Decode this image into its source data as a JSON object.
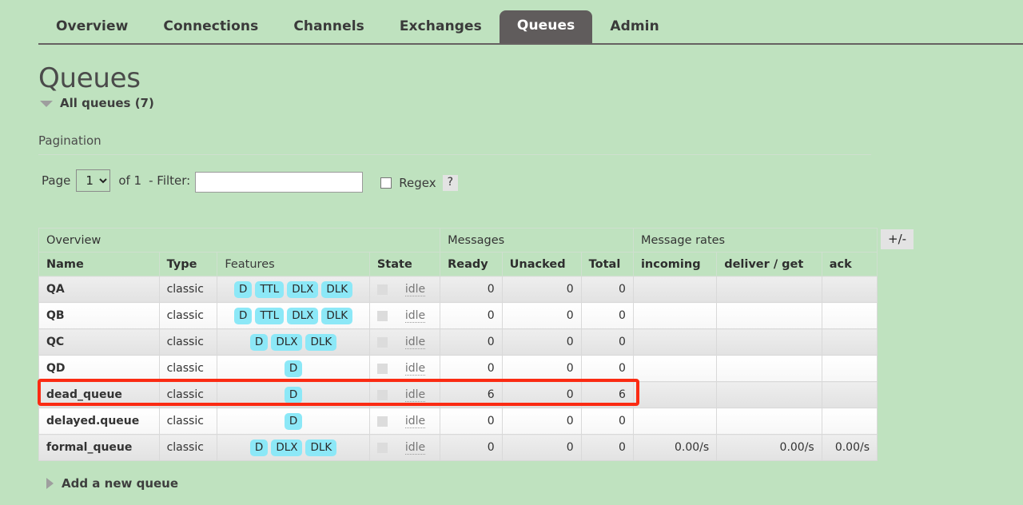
{
  "nav": {
    "items": [
      {
        "label": "Overview",
        "active": false
      },
      {
        "label": "Connections",
        "active": false
      },
      {
        "label": "Channels",
        "active": false
      },
      {
        "label": "Exchanges",
        "active": false
      },
      {
        "label": "Queues",
        "active": true
      },
      {
        "label": "Admin",
        "active": false
      }
    ]
  },
  "page": {
    "title": "Queues",
    "section_toggle": "All queues (7)",
    "pagination_heading": "Pagination",
    "add_queue": "Add a new queue"
  },
  "pagination": {
    "page_label": "Page",
    "page_value": "1",
    "page_options": [
      "1"
    ],
    "of_label": "of 1",
    "filter_label": "- Filter:",
    "filter_value": "",
    "filter_placeholder": "",
    "regex_label": "Regex",
    "regex_checked": false,
    "help_label": "?"
  },
  "table": {
    "group_headers": [
      {
        "label": "Overview",
        "span": 4
      },
      {
        "label": "Messages",
        "span": 3
      },
      {
        "label": "Message rates",
        "span": 3
      }
    ],
    "columns": [
      {
        "label": "Name",
        "sortable": true
      },
      {
        "label": "Type",
        "sortable": true
      },
      {
        "label": "Features",
        "sortable": false
      },
      {
        "label": "State",
        "sortable": true
      },
      {
        "label": "Ready",
        "sortable": true
      },
      {
        "label": "Unacked",
        "sortable": true
      },
      {
        "label": "Total",
        "sortable": true
      },
      {
        "label": "incoming",
        "sortable": true
      },
      {
        "label": "deliver / get",
        "sortable": true
      },
      {
        "label": "ack",
        "sortable": true
      }
    ],
    "columns_toggle": "+/-",
    "rows": [
      {
        "name": "QA",
        "type": "classic",
        "features": [
          "D",
          "TTL",
          "DLX",
          "DLK"
        ],
        "state": "idle",
        "ready": "0",
        "unacked": "0",
        "total": "0",
        "incoming": "",
        "deliver_get": "",
        "ack": "",
        "highlighted": false
      },
      {
        "name": "QB",
        "type": "classic",
        "features": [
          "D",
          "TTL",
          "DLX",
          "DLK"
        ],
        "state": "idle",
        "ready": "0",
        "unacked": "0",
        "total": "0",
        "incoming": "",
        "deliver_get": "",
        "ack": "",
        "highlighted": false
      },
      {
        "name": "QC",
        "type": "classic",
        "features": [
          "D",
          "DLX",
          "DLK"
        ],
        "state": "idle",
        "ready": "0",
        "unacked": "0",
        "total": "0",
        "incoming": "",
        "deliver_get": "",
        "ack": "",
        "highlighted": false
      },
      {
        "name": "QD",
        "type": "classic",
        "features": [
          "D"
        ],
        "state": "idle",
        "ready": "0",
        "unacked": "0",
        "total": "0",
        "incoming": "",
        "deliver_get": "",
        "ack": "",
        "highlighted": false
      },
      {
        "name": "dead_queue",
        "type": "classic",
        "features": [
          "D"
        ],
        "state": "idle",
        "ready": "6",
        "unacked": "0",
        "total": "6",
        "incoming": "",
        "deliver_get": "",
        "ack": "",
        "highlighted": true
      },
      {
        "name": "delayed.queue",
        "type": "classic",
        "features": [
          "D"
        ],
        "state": "idle",
        "ready": "0",
        "unacked": "0",
        "total": "0",
        "incoming": "",
        "deliver_get": "",
        "ack": "",
        "highlighted": false
      },
      {
        "name": "formal_queue",
        "type": "classic",
        "features": [
          "D",
          "DLX",
          "DLK"
        ],
        "state": "idle",
        "ready": "0",
        "unacked": "0",
        "total": "0",
        "incoming": "0.00/s",
        "deliver_get": "0.00/s",
        "ack": "0.00/s",
        "highlighted": false
      }
    ]
  },
  "colors": {
    "page_background": "#bfe2bf",
    "active_tab": "#605c5c",
    "badge": "#8ce8f7",
    "highlight": "#fb2b13",
    "row_odd": "#e8e8e8",
    "row_even": "#fbfbfb"
  }
}
